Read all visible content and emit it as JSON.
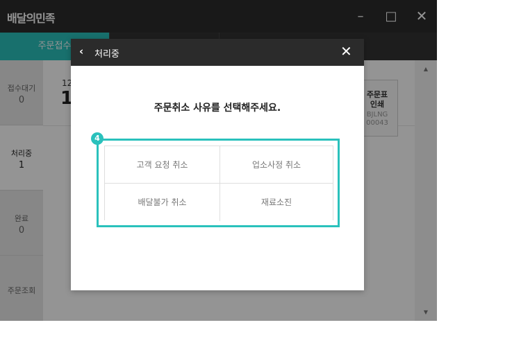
{
  "window": {
    "title": "배달의민족",
    "minimize_glyph": "–",
    "maximize_glyph": "□",
    "close_glyph": "✕"
  },
  "tabs": [
    {
      "label": "주문접수"
    },
    {
      "label": ""
    },
    {
      "label": ""
    }
  ],
  "sidebar": {
    "items": [
      {
        "label": "접수대기",
        "count": "0"
      },
      {
        "label": "처리중",
        "count": "1"
      },
      {
        "label": "완료",
        "count": "0"
      },
      {
        "label": "주문조회",
        "count": ""
      }
    ]
  },
  "order": {
    "time": "12",
    "number": "1",
    "print_label_1": "주문표",
    "print_label_2": "인쇄",
    "print_code_1": "BJLNG",
    "print_code_2": "00043"
  },
  "modal": {
    "back_glyph": "‹",
    "title": "처리중",
    "close_glyph": "✕",
    "question": "주문취소 사유를 선택해주세요.",
    "reasons": [
      "고객 요청 취소",
      "업소사정 취소",
      "배달불가 취소",
      "재료소진"
    ]
  },
  "step_badge": "4",
  "icons": {
    "scroll_up": "chevron-up-icon",
    "scroll_down": "chevron-down-icon",
    "back": "chevron-left-icon",
    "close": "close-icon"
  },
  "colors": {
    "accent": "#2ac1bc",
    "titlebar": "#2b2b2b"
  }
}
